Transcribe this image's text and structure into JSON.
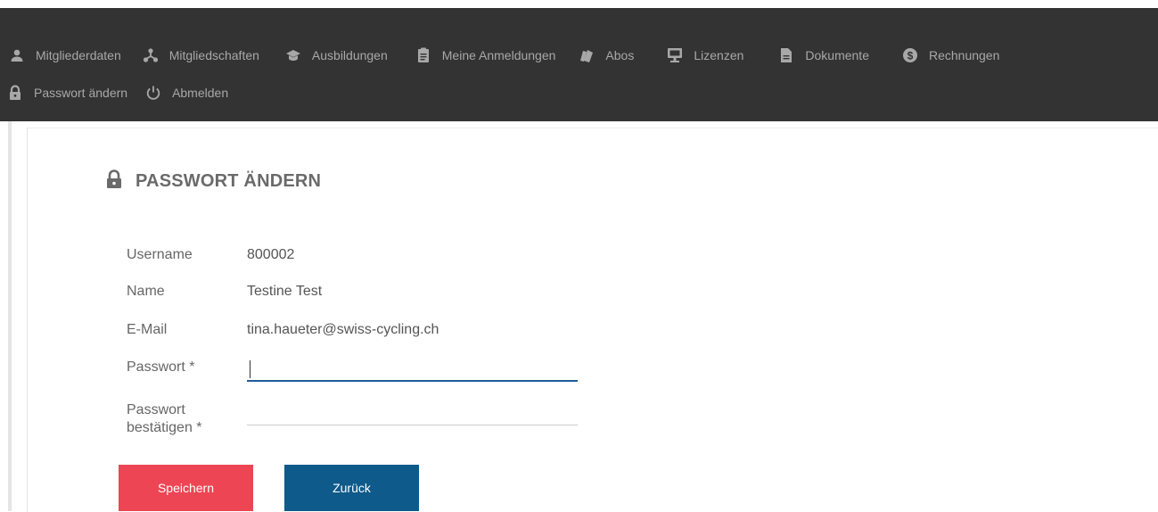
{
  "nav": {
    "items": [
      {
        "label": "Mitgliederdaten",
        "icon": "user-icon"
      },
      {
        "label": "Mitgliedschaften",
        "icon": "network-icon"
      },
      {
        "label": "Ausbildungen",
        "icon": "graduation-cap-icon"
      },
      {
        "label": "Meine Anmeldungen",
        "icon": "clipboard-icon"
      },
      {
        "label": "Abos",
        "icon": "tickets-icon"
      },
      {
        "label": "Lizenzen",
        "icon": "badge-icon"
      },
      {
        "label": "Dokumente",
        "icon": "document-icon"
      },
      {
        "label": "Rechnungen",
        "icon": "dollar-circle-icon"
      },
      {
        "label": "Passwort ändern",
        "icon": "lock-icon"
      },
      {
        "label": "Abmelden",
        "icon": "power-icon"
      }
    ]
  },
  "page": {
    "title": "PASSWORT ÄNDERN"
  },
  "form": {
    "username_label": "Username",
    "username_value": "800002",
    "name_label": "Name",
    "name_value": "Testine Test",
    "email_label": "E-Mail",
    "email_value": "tina.haueter@swiss-cycling.ch",
    "password_label": "Passwort *",
    "password_value": "",
    "confirm_label_line1": "Passwort",
    "confirm_label_line2": "bestätigen *",
    "confirm_value": ""
  },
  "buttons": {
    "save": "Speichern",
    "back": "Zurück"
  },
  "colors": {
    "topbar": "#333333",
    "save": "#ed4553",
    "back": "#0e5a8a",
    "focus_underline": "#1f5c96"
  }
}
